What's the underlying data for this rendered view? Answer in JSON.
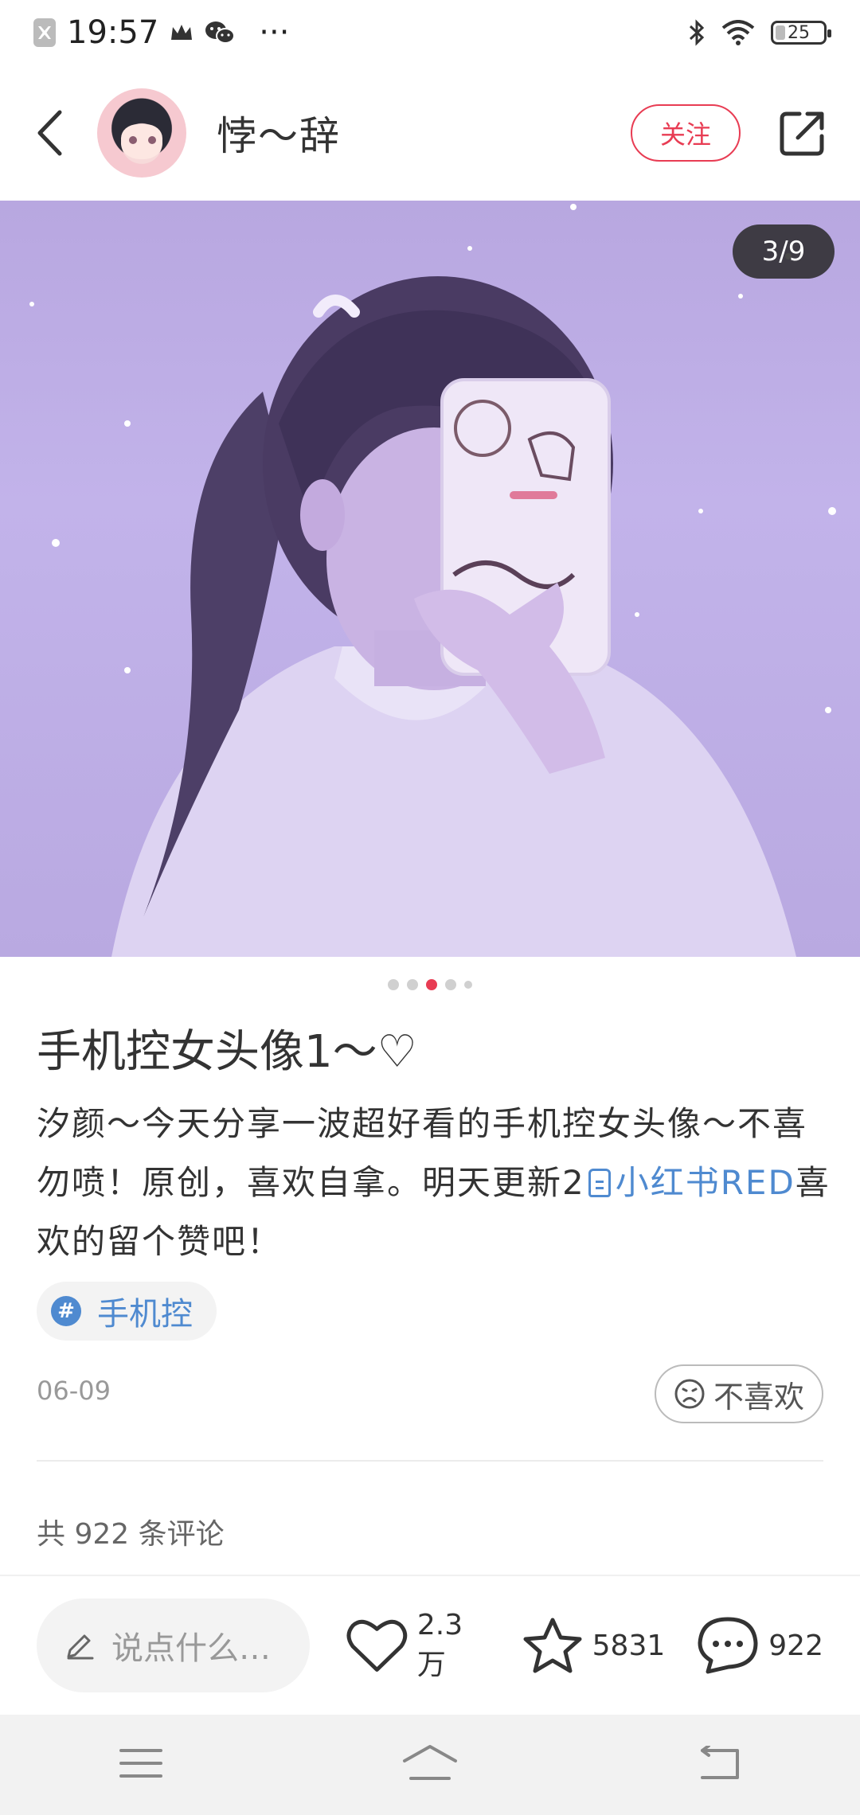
{
  "status_bar": {
    "time": "19:57",
    "more": "···",
    "battery": "25"
  },
  "header": {
    "username": "悖～辞",
    "follow_label": "关注"
  },
  "hero": {
    "page_counter": "3/9"
  },
  "carousel": {
    "total_dots": 5,
    "active_index": 2
  },
  "post": {
    "title": "手机控女头像1～♡",
    "desc_part1": "汐颜～今天分享一波超好看的手机控女头像～不喜勿喷！原创，喜欢自拿。明天更新2",
    "link_text": "小红书RED",
    "desc_part2": "喜欢的留个赞吧！",
    "tag": "手机控",
    "date": "06-09",
    "dislike_label": "不喜欢",
    "comments_total": "共 922 条评论"
  },
  "actions": {
    "comment_placeholder": "说点什么…",
    "likes": "2.3万",
    "collects": "5831",
    "comments": "922"
  },
  "colors": {
    "accent_red": "#e83c53",
    "link_blue": "#4f8ad0",
    "hero_purple": "#b8a7e0"
  }
}
